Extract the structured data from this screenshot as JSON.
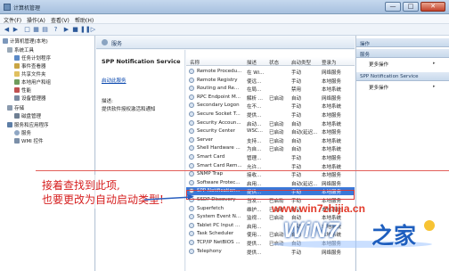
{
  "window": {
    "title": "计算机管理",
    "controls": {
      "minimize": "—",
      "maximize": "□",
      "close": "✕"
    }
  },
  "menubar": {
    "items": [
      "文件(F)",
      "操作(A)",
      "查看(V)",
      "帮助(H)"
    ]
  },
  "toolbar": {
    "icons": [
      "back-icon",
      "forward-icon",
      "up-folder-icon",
      "show-hide-tree-icon",
      "properties-icon",
      "help-icon",
      "play-icon",
      "stop-icon",
      "pause-icon",
      "restart-icon"
    ]
  },
  "tree": {
    "items": [
      {
        "label": "计算机管理(本地)",
        "icon": "computer-icon",
        "level": 0
      },
      {
        "label": "系统工具",
        "icon": "tools-icon",
        "level": 1
      },
      {
        "label": "任务计划程序",
        "icon": "task-scheduler-icon",
        "level": 2
      },
      {
        "label": "事件查看器",
        "icon": "event-viewer-icon",
        "level": 2
      },
      {
        "label": "共享文件夹",
        "icon": "shared-folder-icon",
        "level": 2
      },
      {
        "label": "本地用户和组",
        "icon": "users-icon",
        "level": 2
      },
      {
        "label": "性能",
        "icon": "performance-icon",
        "level": 2
      },
      {
        "label": "设备管理器",
        "icon": "device-manager-icon",
        "level": 2
      },
      {
        "label": "存储",
        "icon": "storage-icon",
        "level": 1
      },
      {
        "label": "磁盘管理",
        "icon": "disk-icon",
        "level": 2
      },
      {
        "label": "服务和应用程序",
        "icon": "services-apps-icon",
        "level": 1
      },
      {
        "label": "服务",
        "icon": "services-icon",
        "level": 2
      },
      {
        "label": "WMI 控件",
        "icon": "wmi-icon",
        "level": 2
      }
    ]
  },
  "services_panel": {
    "header": "服务",
    "selected_service": "SPP Notification Service",
    "start_link": "启动此服务",
    "description_label": "描述:",
    "description": "提供软件授权激活和通知"
  },
  "service_list": {
    "columns": [
      "名称",
      "描述",
      "状态",
      "启动类型",
      "登录为"
    ],
    "rows": [
      [
        "Remote Procedu...",
        "在 Wi...",
        "",
        "手动",
        "网络服务"
      ],
      [
        "Remote Registry",
        "使远...",
        "",
        "手动",
        "本地服务"
      ],
      [
        "Routing and Re...",
        "在局...",
        "",
        "禁用",
        "本地系统"
      ],
      [
        "RPC Endpoint M...",
        "解析 ...",
        "已启动",
        "自动",
        "网络服务"
      ],
      [
        "Secondary Logon",
        "在不...",
        "",
        "手动",
        "本地系统"
      ],
      [
        "Secure Socket T...",
        "提供...",
        "",
        "手动",
        "本地服务"
      ],
      [
        "Security Accoun...",
        "启动...",
        "已启动",
        "自动",
        "本地系统"
      ],
      [
        "Security Center",
        "WSC...",
        "已启动",
        "自动(延迟...",
        "本地服务"
      ],
      [
        "Server",
        "支持...",
        "已启动",
        "自动",
        "本地系统"
      ],
      [
        "Shell Hardware ...",
        "为自...",
        "已启动",
        "自动",
        "本地系统"
      ],
      [
        "Smart Card",
        "管理...",
        "",
        "手动",
        "本地服务"
      ],
      [
        "Smart Card Rem...",
        "允许...",
        "",
        "手动",
        "本地系统"
      ],
      [
        "SNMP Trap",
        "接收...",
        "",
        "手动",
        "本地服务"
      ],
      [
        "Software Protec...",
        "启用...",
        "",
        "自动(延迟...",
        "网络服务"
      ],
      [
        "SPP Notification...",
        "提供...",
        "",
        "手动",
        "本地服务"
      ],
      [
        "SSDP Discovery",
        "当发...",
        "已启动",
        "手动",
        "本地服务"
      ],
      [
        "Superfetch",
        "维护...",
        "已启动",
        "自动",
        "本地系统"
      ],
      [
        "System Event N...",
        "监视...",
        "已启动",
        "自动",
        "本地系统"
      ],
      [
        "Tablet PC Input ...",
        "启用...",
        "",
        "手动",
        "本地系统"
      ],
      [
        "Task Scheduler",
        "使用...",
        "已启动",
        "自动",
        "本地系统"
      ],
      [
        "TCP/IP NetBIOS ...",
        "提供...",
        "已启动",
        "自动",
        "本地服务"
      ],
      [
        "Telephony",
        "提供...",
        "",
        "手动",
        "网络服务"
      ]
    ],
    "selected_index": 14
  },
  "actions": {
    "title": "操作",
    "sections": [
      {
        "header": "服务",
        "items": [
          "更多操作"
        ]
      },
      {
        "header": "SPP Notification Service",
        "items": [
          "更多操作"
        ]
      }
    ]
  },
  "annotation": {
    "line1": "接着查找到此项,",
    "line2": "也要更改为自动启动类型!",
    "color": "#d62020"
  },
  "watermark": {
    "url": "www.win7zhijia.cn",
    "logo_text": "WiN7",
    "logo_char": "之家"
  }
}
